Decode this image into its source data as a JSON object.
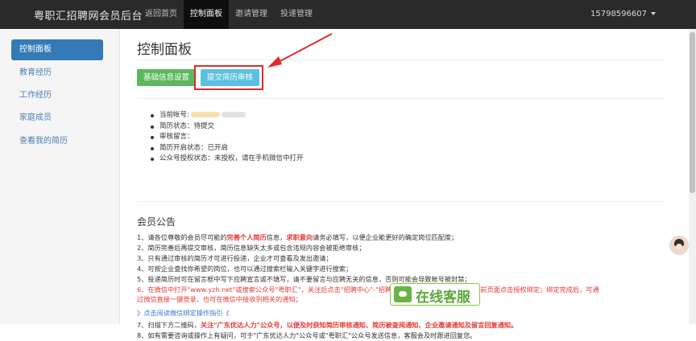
{
  "header": {
    "brand": "粤职汇招聘网会员后台",
    "nav": [
      "返回首页",
      "控制面板",
      "邀请管理",
      "投递管理"
    ],
    "user": "15798596607"
  },
  "sidebar": {
    "items": [
      {
        "label": "控制面板",
        "active": true
      },
      {
        "label": "教育经历"
      },
      {
        "label": "工作经历"
      },
      {
        "label": "家庭成员"
      },
      {
        "label": "查看我的简历"
      }
    ]
  },
  "main": {
    "title": "控制面板",
    "btn_basic": "基础信息设置",
    "btn_submit": "提交简历审核",
    "info": {
      "account_label": "当前帐号:",
      "resume_status": "简历状态：待提交",
      "review_note": "审核留言：",
      "resume_open": "简历开启状态：已开启",
      "wechat_auth": "公众号授权状态：未授权，请在手机微信中打开"
    },
    "notice_title": "会员公告",
    "rules": {
      "r1a": "1、请各位尊敬的会员尽可能的",
      "r1b": "完善个人简历",
      "r1c": "信息，",
      "r1d": "求职意向",
      "r1e": "请务必填写，以便企业能更好的确定岗位匹配度；",
      "r2": "2、简历完善后再提交审核，简历信息缺失太多或包含违规内容会被拒绝审核；",
      "r3": "3、只有通过审核的简历才可进行投递，企业才可查看及发出邀请；",
      "r4": "4、可按企业查找你希望的岗位，也可以通过搜索栏输入关键字进行搜索；",
      "r5": "5、投递简历时可在留言框中写下应聘宣言或不填写，请不要留言与应聘无关的信息，否则可能会导致帐号被封禁；",
      "r6a": "6、在微信中打开\"www.yzh.net\"或搜索公众号\"粤职汇\"，关注后点击\"招聘中心\"-\"招聘会\"，登录或注册会员后，在当前页面点击授权绑定；绑定完成后，可通",
      "r6b": "过微信直接一键登录，也可在微信中接收到相关的通知；",
      "link": "》点击阅读微信绑定操作指引《",
      "r7a": "7、扫描下方二维码，",
      "r7b": "关注\"广东优达人力\"公众号，以便及时获知简历审核通知、简历被查阅通知、企业邀请通知及留言回复通知。",
      "r8": "8、如有需要咨询或操作上有疑问，可于\"广东优达人力\"公众号或\"粤职汇\"公众号发送信息，客服会及时跟进回复您。"
    },
    "service_label": "在线客服"
  },
  "colors": {
    "green": "#5cb85c",
    "blue": "#5bc0de",
    "accent": "#337ab7",
    "red": "#e53935",
    "highlight": "#e02a2a"
  }
}
